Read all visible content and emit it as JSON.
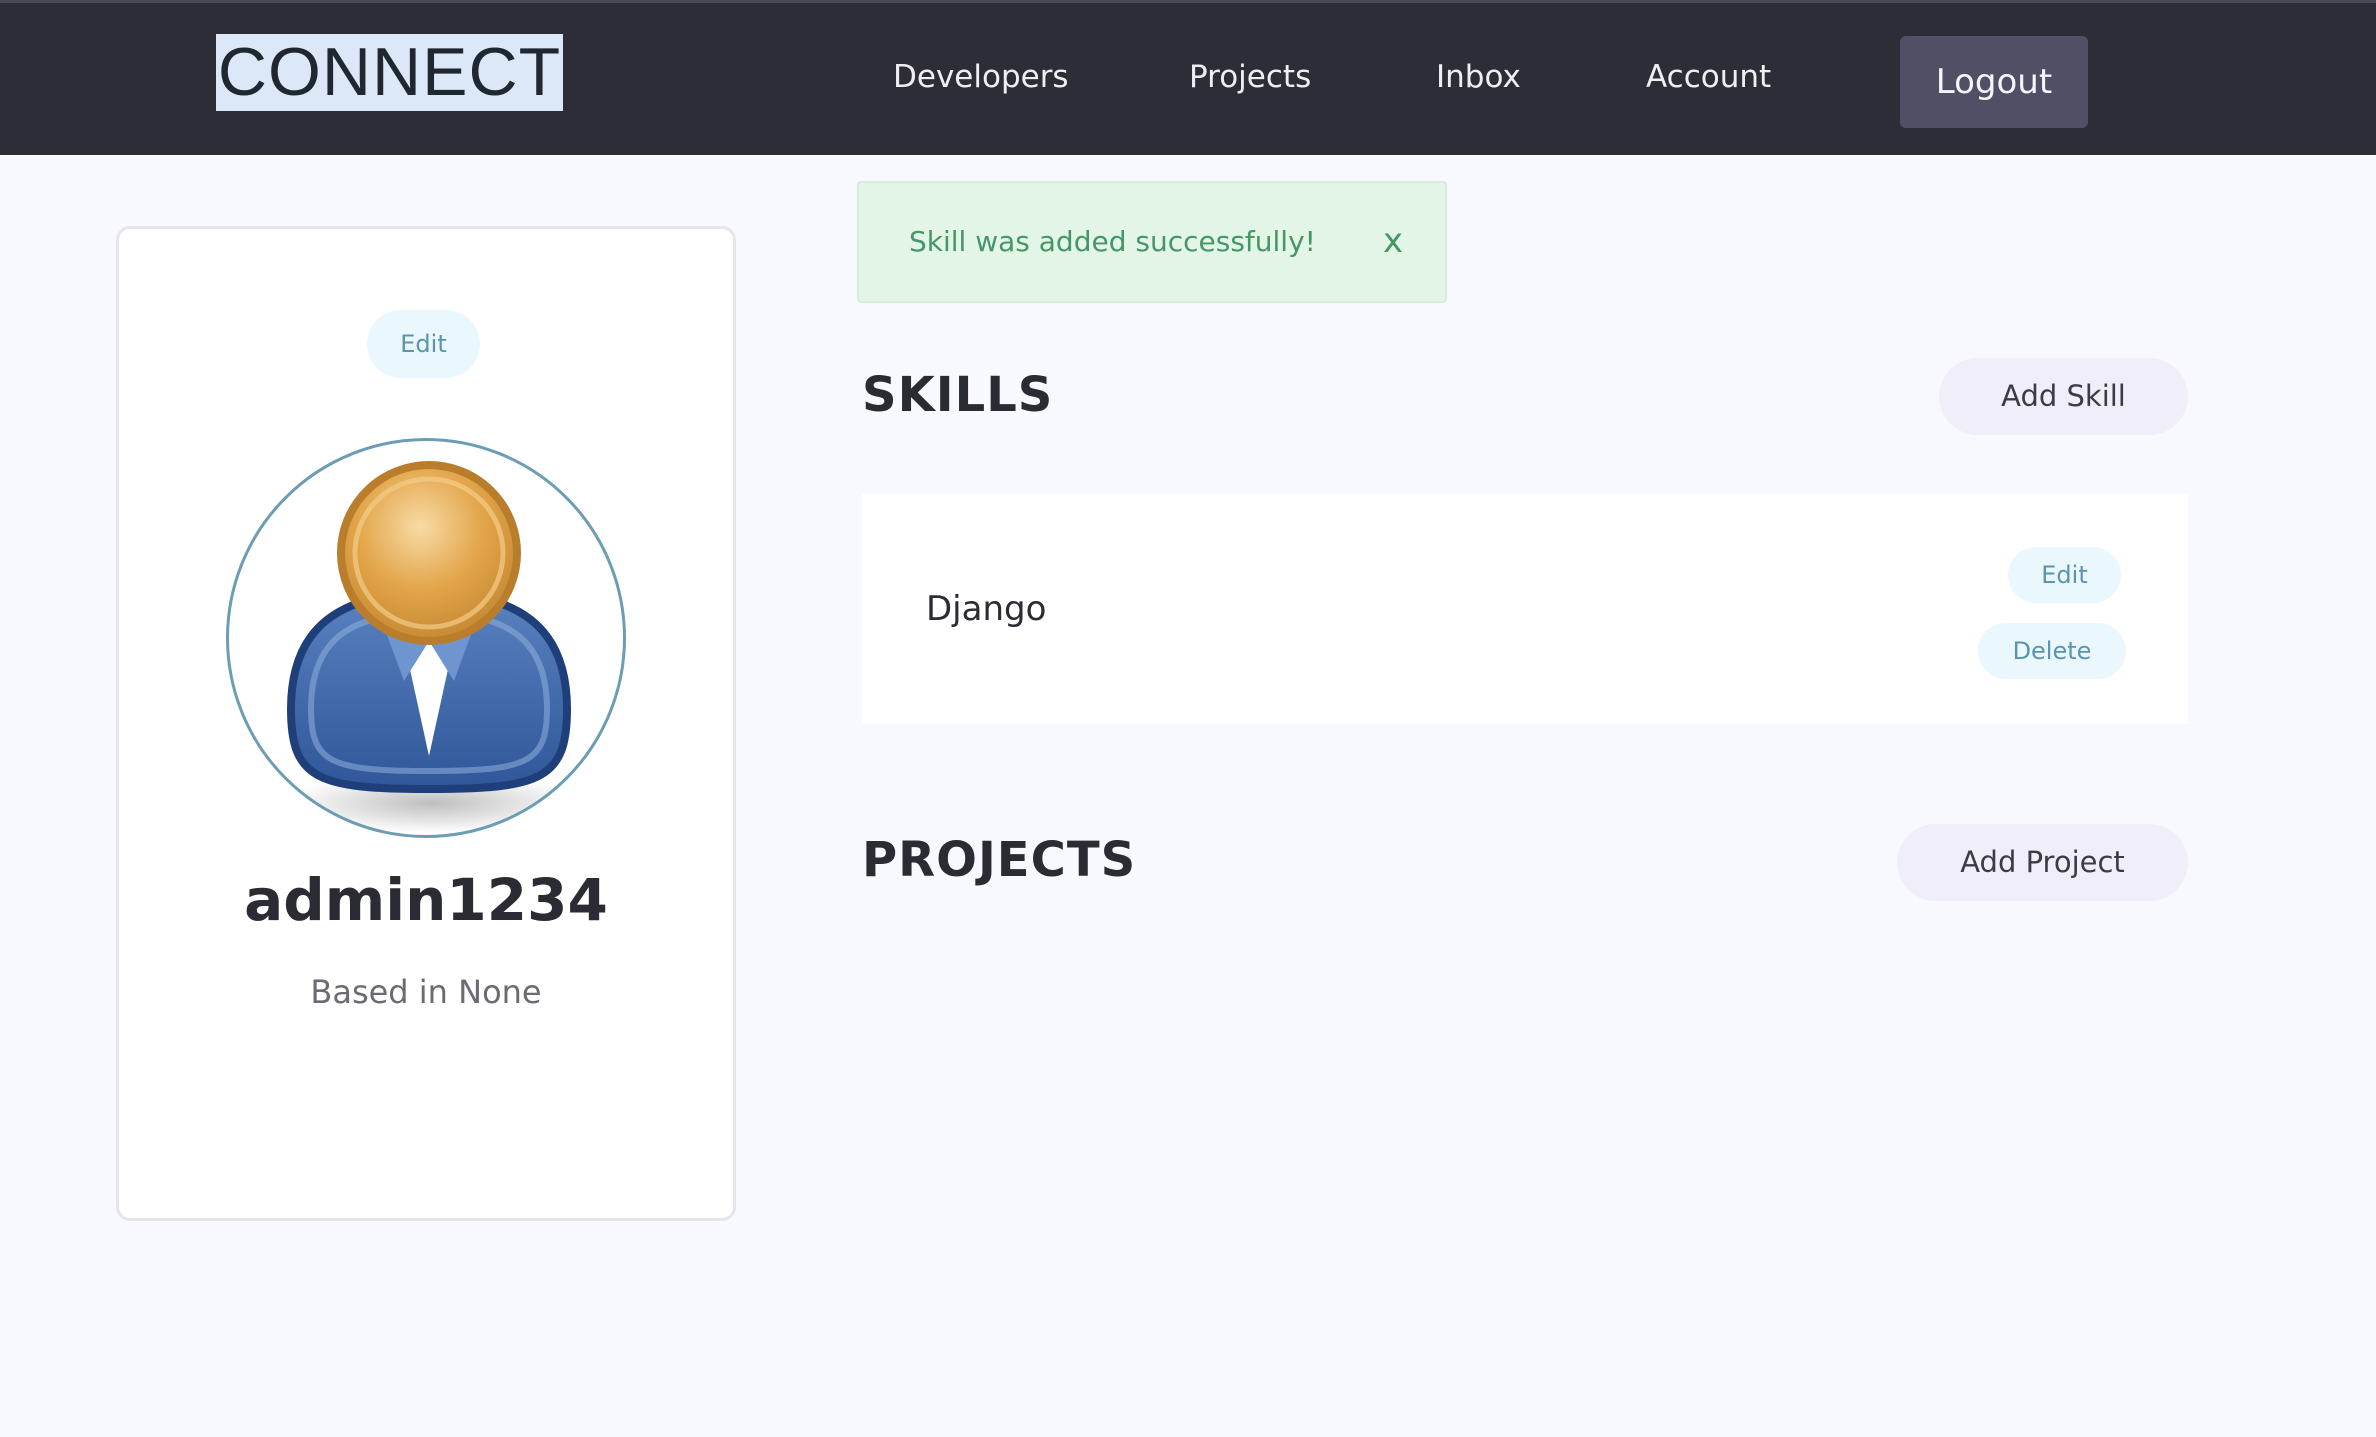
{
  "header": {
    "logo": "CONNECT",
    "nav": [
      "Developers",
      "Projects",
      "Inbox",
      "Account"
    ],
    "logout_label": "Logout"
  },
  "profile": {
    "edit_label": "Edit",
    "username": "admin1234",
    "location": "Based in None",
    "avatar_icon": "user-avatar-icon"
  },
  "alert": {
    "message": "Skill was added successfully!",
    "close_label": "x"
  },
  "skills": {
    "title": "SKILLS",
    "add_label": "Add Skill",
    "items": [
      {
        "name": "Django",
        "edit_label": "Edit",
        "delete_label": "Delete"
      }
    ]
  },
  "projects": {
    "title": "PROJECTS",
    "add_label": "Add Project"
  },
  "colors": {
    "header_bg": "#2d2d37",
    "page_bg": "#f8f9fe",
    "alert_bg": "#e2f5e7",
    "alert_text": "#469666",
    "pill_bg": "#eaf8fd",
    "pill_text": "#5a95b0"
  }
}
